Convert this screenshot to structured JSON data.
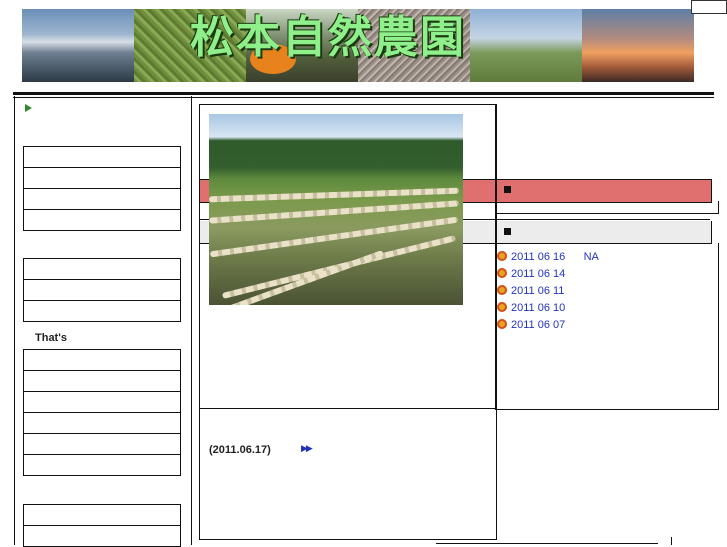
{
  "header": {
    "site_title": "松本自然農園"
  },
  "sidebar": {
    "thats_label": "That's"
  },
  "post": {
    "date": "(2011.06.17)",
    "more_icon": "double-arrow-icon"
  },
  "recent_entries": [
    {
      "date": "2011 06 16",
      "extra": "NA"
    },
    {
      "date": "2011 06 14",
      "extra": ""
    },
    {
      "date": "2011 06 11",
      "extra": ""
    },
    {
      "date": "2011 06 10",
      "extra": ""
    },
    {
      "date": "2011 06 07",
      "extra": ""
    }
  ],
  "colors": {
    "accent_bar": "#e07070",
    "link": "#2233bb",
    "title_green": "#8fef8a"
  }
}
